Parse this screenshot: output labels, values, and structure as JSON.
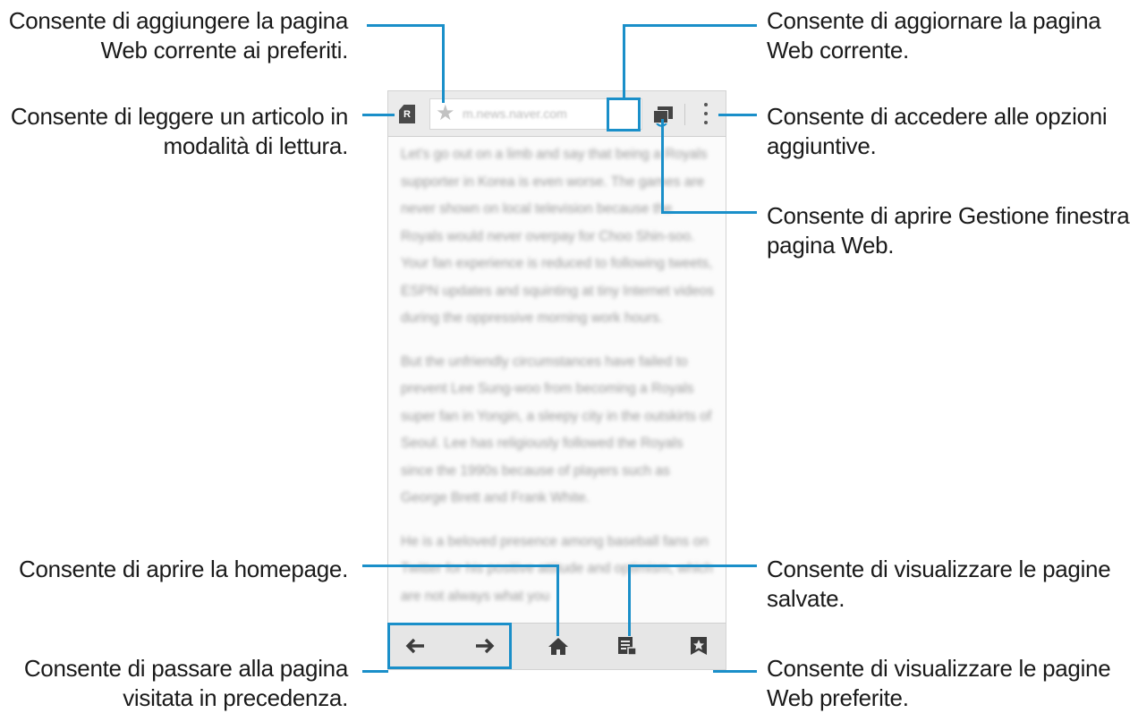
{
  "annotations": {
    "bookmark": [
      "Consente di aggiungere la pagina",
      "Web corrente ai preferiti."
    ],
    "reader": [
      "Consente di leggere un articolo in",
      "modalità di lettura."
    ],
    "refresh": [
      "Consente di aggiornare la pagina",
      "Web corrente."
    ],
    "options": [
      "Consente di accedere alle opzioni",
      "aggiuntive."
    ],
    "windows": [
      "Consente di aprire Gestione finestra",
      "pagina Web."
    ],
    "home": [
      "Consente di aprire la homepage."
    ],
    "saved": [
      "Consente di visualizzare le pagine",
      "salvate."
    ],
    "backforward": [
      "Consente di passare alla pagina",
      "visitata in precedenza."
    ],
    "favorites": [
      "Consente di visualizzare le pagine",
      "Web preferite."
    ]
  },
  "browser": {
    "url": "m.news.naver.com",
    "reader_icon_letter": "R",
    "paragraphs": [
      "Let's go out on a limb and say that being a Royals supporter in Korea is even worse. The games are never shown on local television because the Royals would never overpay for Choo Shin-soo. Your fan experience is reduced to following tweets, ESPN updates and squinting at tiny Internet videos during the oppressive morning work hours.",
      "But the unfriendly circumstances have failed to prevent Lee Sung-woo from becoming a Royals super fan in Yongin, a sleepy city in the outskirts of Seoul. Lee has religiously followed the Royals since the 1990s because of players such as George Brett and Frank White.",
      "He is a beloved presence among baseball fans on Twitter for his positive attitude and optimism, which are not always what you"
    ],
    "accent_color": "#1a8fc9"
  }
}
